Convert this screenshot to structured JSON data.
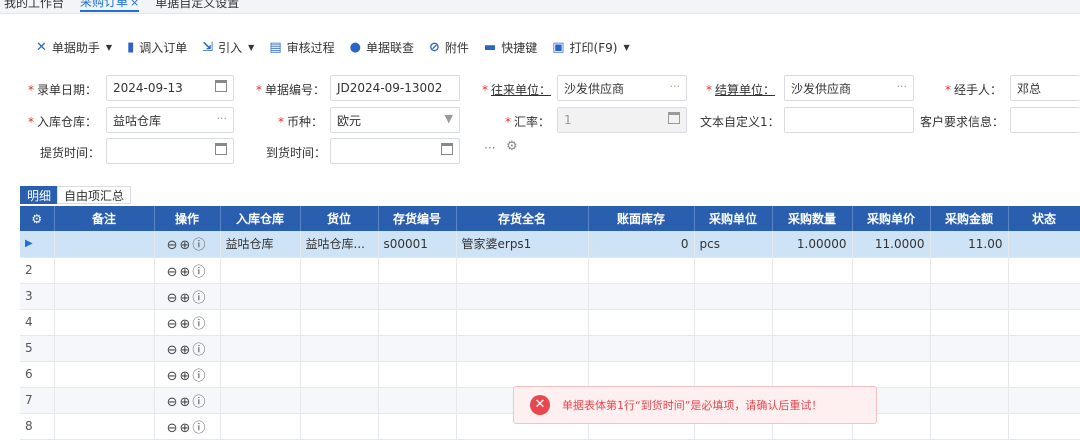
{
  "tabs": [
    {
      "label": "我的工作台",
      "active": false
    },
    {
      "label": "采购订单",
      "active": true,
      "close": "×"
    },
    {
      "label": "单据自定义设置",
      "active": false
    }
  ],
  "toolbar": {
    "doc_assistant": "单据助手",
    "import_order": "调入订单",
    "import": "引入",
    "audit_process": "审核过程",
    "doc_link": "单据联查",
    "attachment": "附件",
    "shortcut": "快捷键",
    "print": "打印(F9)"
  },
  "form": {
    "entry_date_label": "录单日期：",
    "entry_date": "2024-09-13",
    "doc_no_label": "单据编号：",
    "doc_no": "JD2024-09-13002",
    "partner_label": "往来单位：",
    "partner": "沙发供应商",
    "settle_label": "结算单位：",
    "settle": "沙发供应商",
    "handler_label": "经手人：",
    "handler": "邓总",
    "warehouse_label": "入库仓库：",
    "warehouse": "益咕仓库",
    "currency_label": "币种：",
    "currency": "欧元",
    "rate_label": "汇率：",
    "rate": "1",
    "custom1_label": "文本自定义1：",
    "custom1": "",
    "customer_req_label": "客户要求信息：",
    "customer_req": "",
    "pickup_label": "提货时间：",
    "pickup": "",
    "arrival_label": "到货时间：",
    "arrival": "",
    "ellipsis": "···"
  },
  "subtabs": [
    "明细",
    "自由项汇总"
  ],
  "grid": {
    "headers": [
      "",
      "备注",
      "操作",
      "入库仓库",
      "货位",
      "存货编号",
      "存货全名",
      "账面库存",
      "采购单位",
      "采购数量",
      "采购单价",
      "采购金额",
      "状态"
    ],
    "rows": [
      {
        "num": "▶",
        "note": "",
        "ops": "⊖⊕ⓘ",
        "warehouse": "益咕仓库",
        "location": "益咕仓库...",
        "code": "s00001",
        "name": "管家婆erps1",
        "stock": "0",
        "unit": "pcs",
        "qty": "1.00000",
        "price": "11.0000",
        "amount": "11.00",
        "status": ""
      },
      {
        "num": "2",
        "ops": "⊖⊕ⓘ"
      },
      {
        "num": "3",
        "ops": "⊖⊕ⓘ"
      },
      {
        "num": "4",
        "ops": "⊖⊕ⓘ"
      },
      {
        "num": "5",
        "ops": "⊖⊕ⓘ"
      },
      {
        "num": "6",
        "ops": "⊖⊕ⓘ"
      },
      {
        "num": "7",
        "ops": "⊖⊕ⓘ"
      },
      {
        "num": "8",
        "ops": "⊖⊕ⓘ"
      }
    ]
  },
  "toast": {
    "message": "单据表体第1行“到货时间”是必填项，请确认后重试！"
  }
}
